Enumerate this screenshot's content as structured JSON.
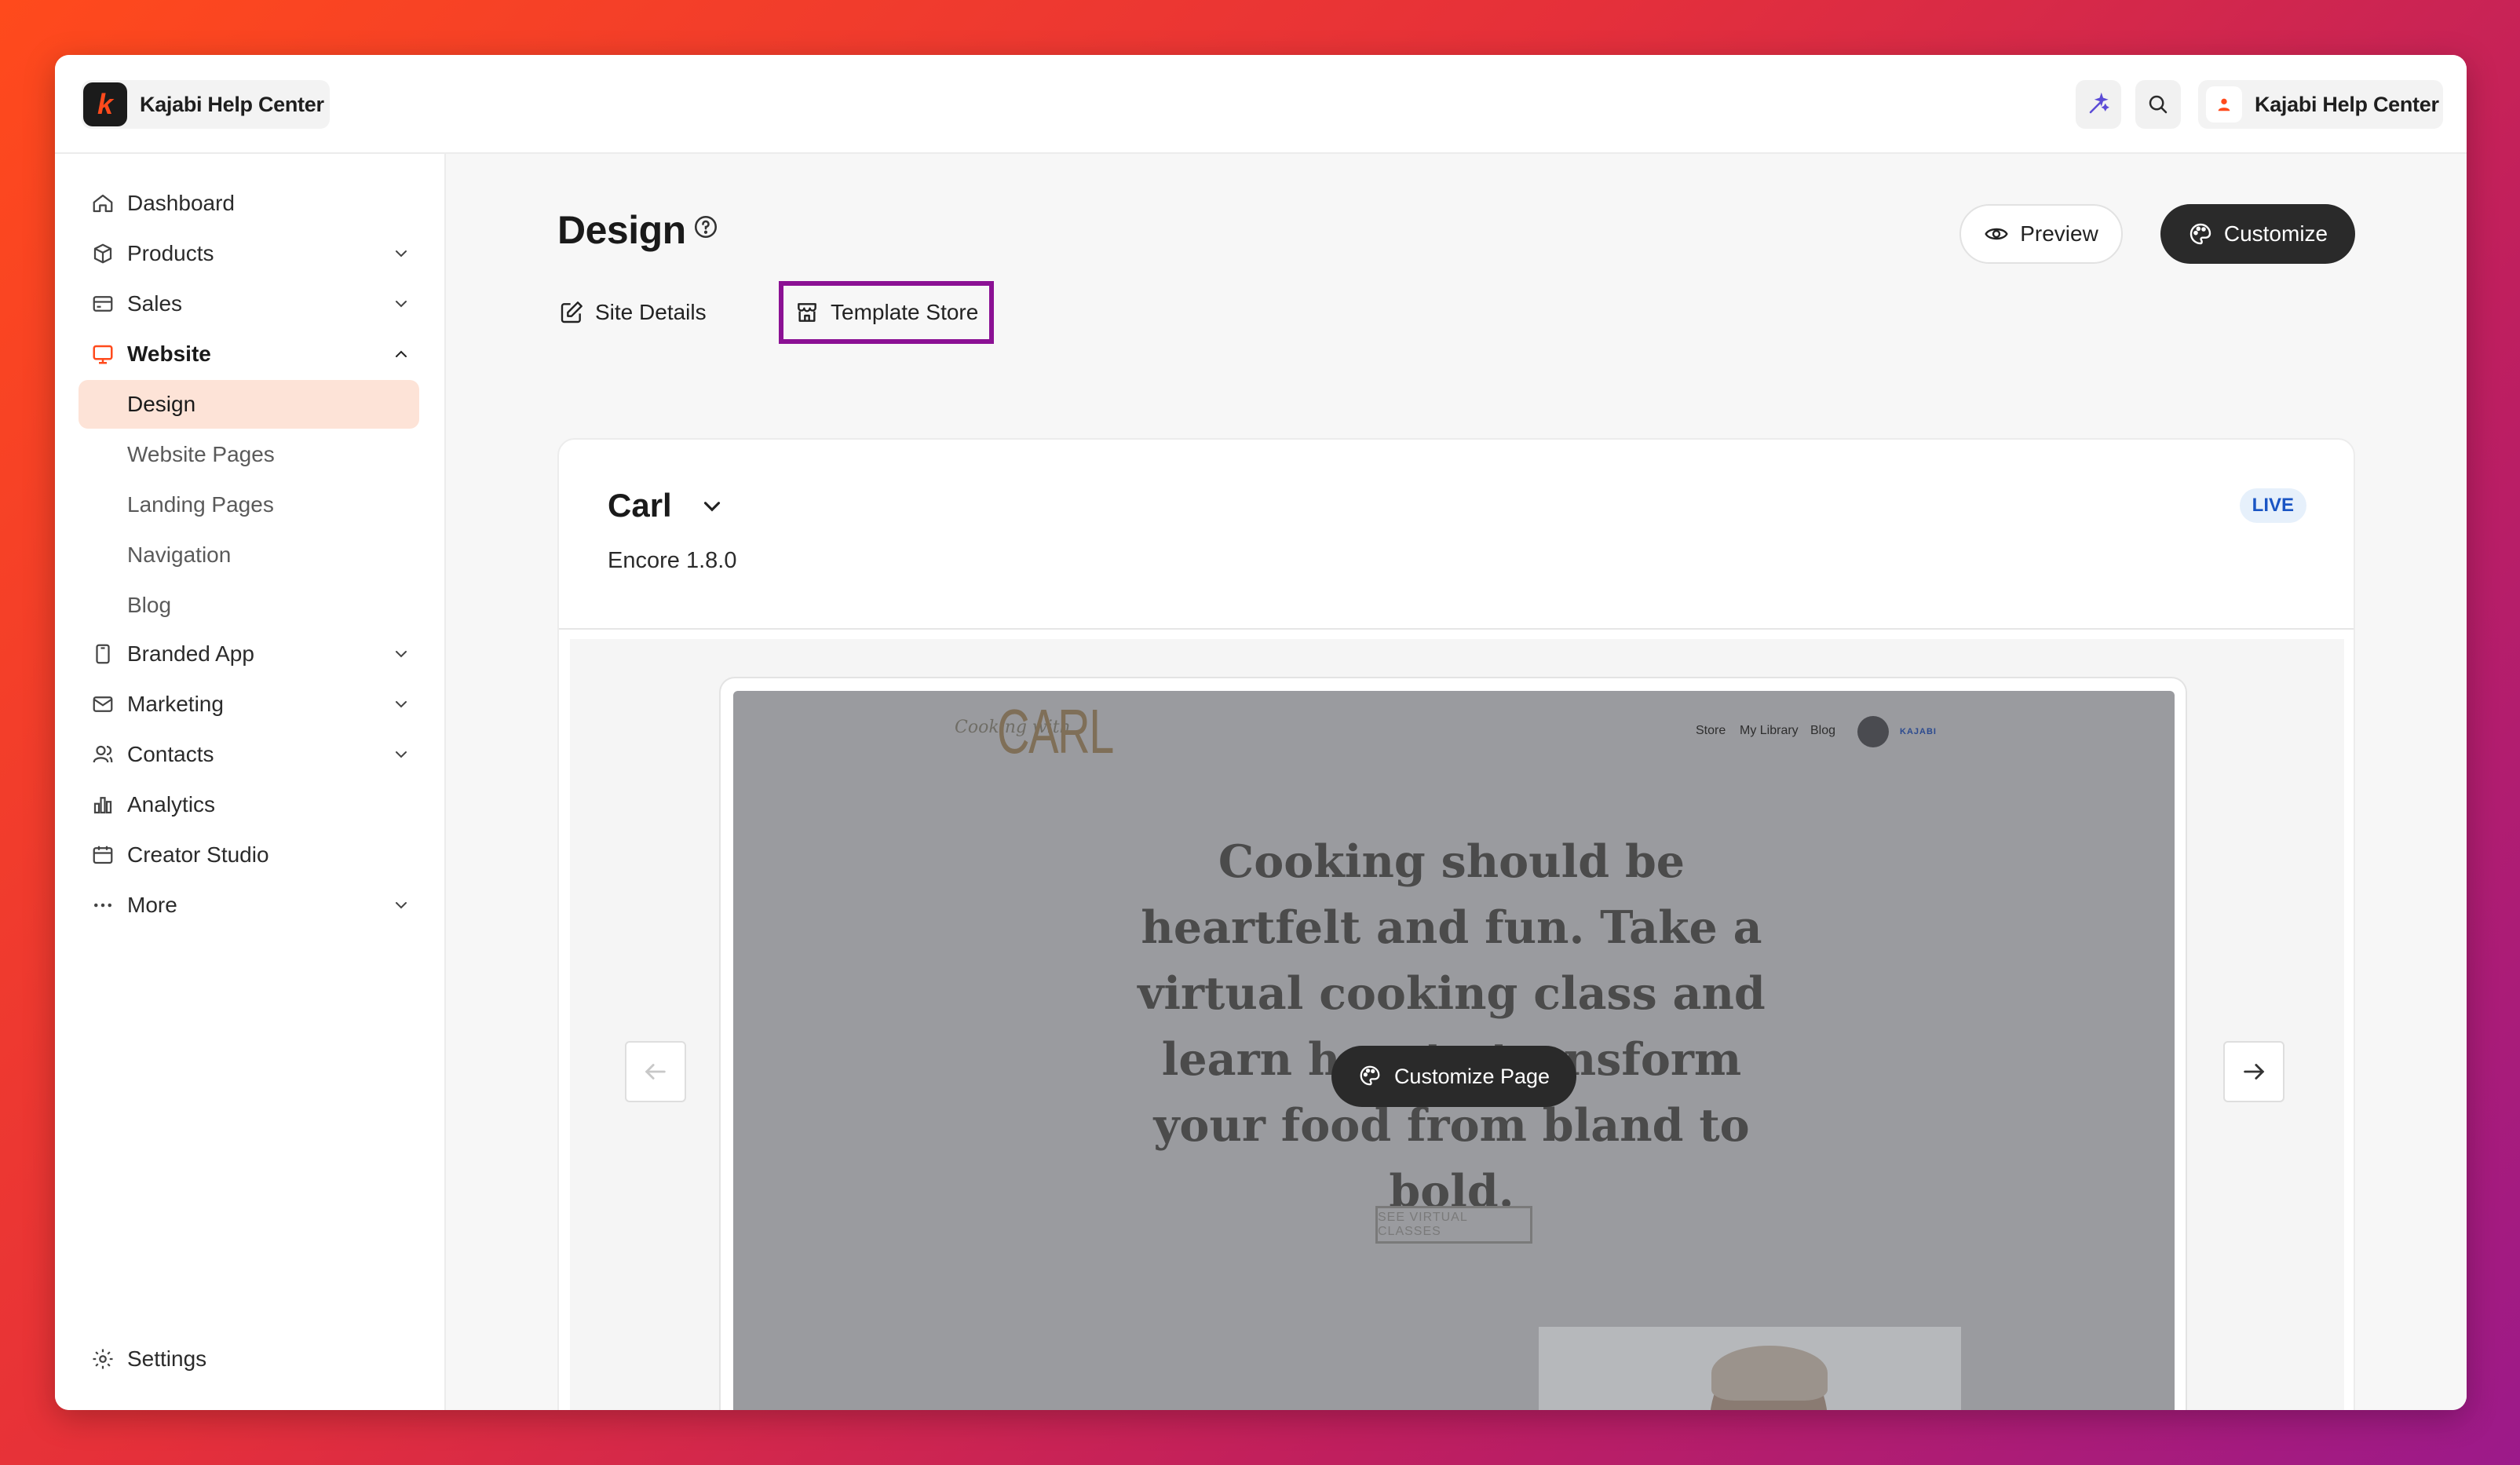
{
  "app": {
    "brand_name": "Kajabi Help Center",
    "brand_logo_letter": "k",
    "user_name": "Kajabi Help Center",
    "accent_color": "#ff4a1c",
    "highlight_color": "#8b1194"
  },
  "sidebar": {
    "items": [
      {
        "label": "Dashboard",
        "icon": "home-icon"
      },
      {
        "label": "Products",
        "icon": "box-icon",
        "expandable": true
      },
      {
        "label": "Sales",
        "icon": "credit-card-icon",
        "expandable": true
      },
      {
        "label": "Website",
        "icon": "monitor-icon",
        "expanded": true
      },
      {
        "label": "Branded App",
        "icon": "phone-icon",
        "expandable": true
      },
      {
        "label": "Marketing",
        "icon": "mail-icon",
        "expandable": true
      },
      {
        "label": "Contacts",
        "icon": "users-icon",
        "expandable": true
      },
      {
        "label": "Analytics",
        "icon": "bar-chart-icon"
      },
      {
        "label": "Creator Studio",
        "icon": "calendar-icon"
      },
      {
        "label": "More",
        "icon": "more-dots-icon",
        "expandable": true
      }
    ],
    "website_subitems": [
      {
        "label": "Design",
        "selected": true
      },
      {
        "label": "Website Pages"
      },
      {
        "label": "Landing Pages"
      },
      {
        "label": "Navigation"
      },
      {
        "label": "Blog"
      }
    ],
    "settings_label": "Settings"
  },
  "main": {
    "title": "Design",
    "preview_label": "Preview",
    "customize_label": "Customize",
    "tabs": [
      {
        "label": "Site Details",
        "icon": "edit-icon"
      },
      {
        "label": "Template Store",
        "icon": "store-icon",
        "highlighted": true
      }
    ],
    "theme": {
      "name": "Carl",
      "version": "Encore 1.8.0",
      "status": "LIVE"
    },
    "preview": {
      "customize_page_label": "Customize Page",
      "site": {
        "script_text": "Cooking with",
        "logo_text": "CARL",
        "nav": [
          "Store",
          "My Library",
          "Blog"
        ],
        "kajabi_badge": "KAJABI",
        "hero_text": "Cooking should be heartfelt and fun. Take a virtual cooking class and learn how to transform your food from bland to bold.",
        "cta_label": "SEE VIRTUAL CLASSES"
      }
    }
  }
}
